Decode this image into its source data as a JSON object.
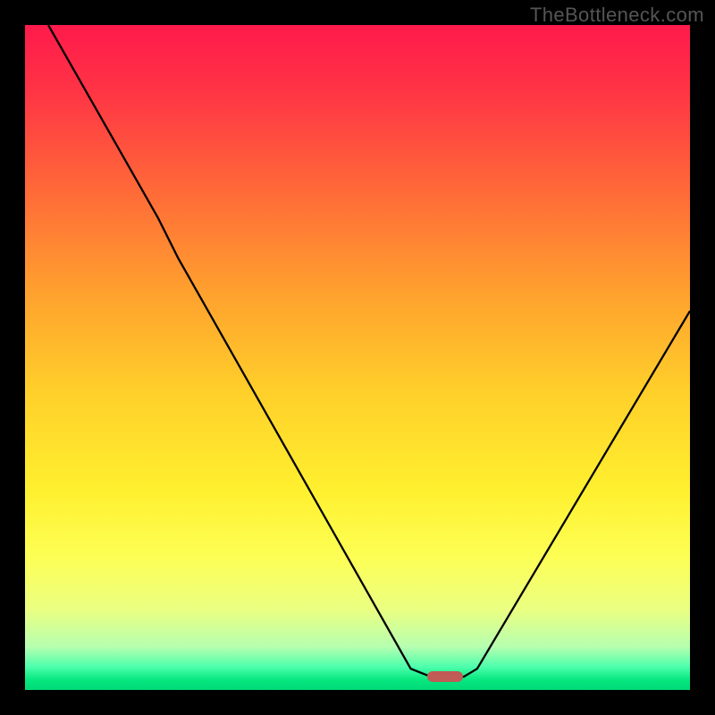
{
  "watermark": "TheBottleneck.com",
  "colors": {
    "frame": "#000000",
    "curve_stroke": "#000000",
    "marker": "#c15b55",
    "gradient_stops": [
      {
        "offset": 0.0,
        "color": "#ff1a4b"
      },
      {
        "offset": 0.1,
        "color": "#ff3445"
      },
      {
        "offset": 0.25,
        "color": "#ff6a38"
      },
      {
        "offset": 0.4,
        "color": "#ffa02e"
      },
      {
        "offset": 0.55,
        "color": "#ffcf2a"
      },
      {
        "offset": 0.7,
        "color": "#fff02f"
      },
      {
        "offset": 0.8,
        "color": "#fdff55"
      },
      {
        "offset": 0.88,
        "color": "#eaff82"
      },
      {
        "offset": 0.935,
        "color": "#b6ffb0"
      },
      {
        "offset": 0.965,
        "color": "#4dffac"
      },
      {
        "offset": 0.985,
        "color": "#06e77f"
      },
      {
        "offset": 1.0,
        "color": "#00d877"
      }
    ]
  },
  "chart_data": {
    "type": "line",
    "title": "",
    "xlabel": "",
    "ylabel": "",
    "xlim": [
      0,
      100
    ],
    "ylim": [
      0,
      100
    ],
    "series": [
      {
        "name": "bottleneck-curve",
        "points": [
          {
            "x": 3.5,
            "y": 100
          },
          {
            "x": 20,
            "y": 71
          },
          {
            "x": 23,
            "y": 65
          },
          {
            "x": 58,
            "y": 3.2
          },
          {
            "x": 61,
            "y": 2
          },
          {
            "x": 66,
            "y": 2
          },
          {
            "x": 68,
            "y": 3.2
          },
          {
            "x": 100,
            "y": 57
          }
        ]
      }
    ],
    "marker": {
      "x_center": 63.2,
      "y": 2,
      "width_pct": 5.3
    }
  }
}
